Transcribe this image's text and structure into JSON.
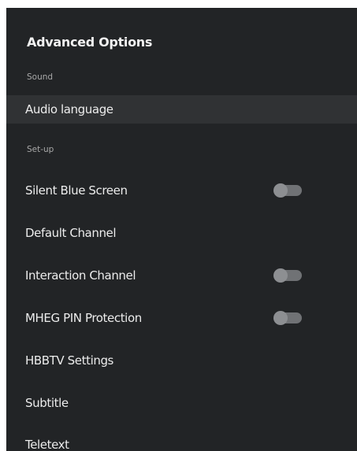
{
  "header": {
    "title": "Advanced Options"
  },
  "sections": [
    {
      "label": "Sound",
      "items": [
        {
          "label": "Audio language",
          "focused": true
        }
      ]
    },
    {
      "label": "Set-up",
      "items": [
        {
          "label": "Silent Blue Screen",
          "toggle": {
            "state": "off"
          }
        },
        {
          "label": "Default Channel"
        },
        {
          "label": "Interaction Channel",
          "toggle": {
            "state": "off"
          }
        },
        {
          "label": "MHEG PIN Protection",
          "toggle": {
            "state": "off"
          }
        },
        {
          "label": "HBBTV Settings"
        },
        {
          "label": "Subtitle"
        },
        {
          "label": "Teletext"
        }
      ]
    }
  ],
  "colors": {
    "panel_background": "#222426",
    "focus_highlight": "#303234",
    "toggle_track_off": "#707275",
    "toggle_knob_off": "#8d8f92"
  }
}
